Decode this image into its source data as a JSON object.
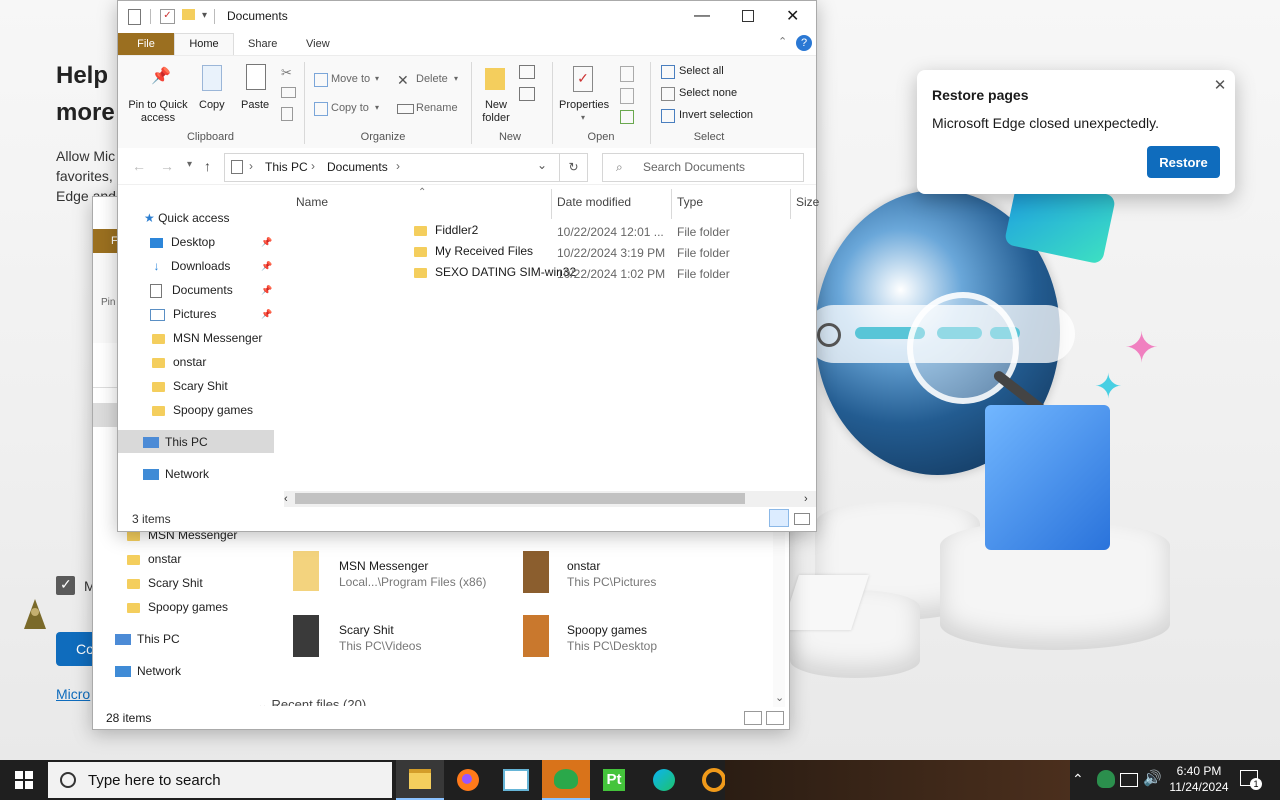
{
  "edge_background": {
    "headline_line1": "Help ",
    "headline_line2": "more",
    "body_line1": "Allow Mic",
    "body_line2": "favorites, ",
    "body_line3": "Edge and ",
    "checkbox_label": "M",
    "button_label": "Co",
    "link_label": "Micro"
  },
  "restore_dialog": {
    "title": "Restore pages",
    "message": "Microsoft Edge closed unexpectedly.",
    "button": "Restore",
    "accent": "#0f6cbd"
  },
  "explorer_back": {
    "nav_items": [
      "MSN Messenger",
      "onstar",
      "Scary Shit",
      "Spoopy games"
    ],
    "this_pc": "This PC",
    "network": "Network",
    "status": "28 items",
    "recent_files": "Recent files (20)",
    "frequent": [
      {
        "name": "MSN Messenger",
        "path": "Local...\\Program Files (x86)"
      },
      {
        "name": "onstar",
        "path": "This PC\\Pictures"
      },
      {
        "name": "Scary Shit",
        "path": "This PC\\Videos"
      },
      {
        "name": "Spoopy games",
        "path": "This PC\\Desktop"
      }
    ],
    "partial_tab": "F",
    "partial_text": "Pin"
  },
  "explorer": {
    "title": "Documents",
    "tabs": [
      "File",
      "Home",
      "Share",
      "View"
    ],
    "ribbon": {
      "clipboard": {
        "label": "Clipboard",
        "pin": "Pin to Quick access",
        "copy": "Copy",
        "paste": "Paste"
      },
      "organize": {
        "label": "Organize",
        "move_to": "Move to",
        "copy_to": "Copy to",
        "delete": "Delete",
        "rename": "Rename"
      },
      "new": {
        "label": "New",
        "new_folder": "New folder"
      },
      "open": {
        "label": "Open",
        "properties": "Properties"
      },
      "select": {
        "label": "Select",
        "select_all": "Select all",
        "select_none": "Select none",
        "invert_selection": "Invert selection"
      }
    },
    "address": {
      "path": [
        "This PC",
        "Documents"
      ]
    },
    "search_placeholder": "Search Documents",
    "nav": {
      "quick_access": "Quick access",
      "items": [
        {
          "label": "Desktop",
          "icon": "desktop-icon",
          "pinned": true
        },
        {
          "label": "Downloads",
          "icon": "downloads-icon",
          "pinned": true
        },
        {
          "label": "Documents",
          "icon": "documents-icon",
          "pinned": true
        },
        {
          "label": "Pictures",
          "icon": "pictures-icon",
          "pinned": true
        },
        {
          "label": "MSN Messenger",
          "icon": "folder-icon",
          "pinned": false
        },
        {
          "label": "onstar",
          "icon": "folder-icon",
          "pinned": false
        },
        {
          "label": "Scary Shit",
          "icon": "folder-icon",
          "pinned": false
        },
        {
          "label": "Spoopy games",
          "icon": "folder-icon",
          "pinned": false
        }
      ],
      "this_pc": "This PC",
      "network": "Network"
    },
    "columns": [
      "Name",
      "Date modified",
      "Type",
      "Size"
    ],
    "files": [
      {
        "name": "Fiddler2",
        "date": "10/22/2024 12:01 ...",
        "type": "File folder"
      },
      {
        "name": "My Received Files",
        "date": "10/22/2024 3:19 PM",
        "type": "File folder"
      },
      {
        "name": "SEXO DATING SIM-win32",
        "date": "10/22/2024 1:02 PM",
        "type": "File folder"
      }
    ],
    "status": "3 items"
  },
  "taskbar": {
    "search_placeholder": "Type here to search",
    "time": "6:40 PM",
    "date": "11/24/2024",
    "notification_count": "1",
    "apps": [
      "file-explorer-icon",
      "firefox-icon",
      "app-icon",
      "messenger-icon",
      "pt-icon",
      "edge-icon",
      "search-app-icon"
    ]
  }
}
